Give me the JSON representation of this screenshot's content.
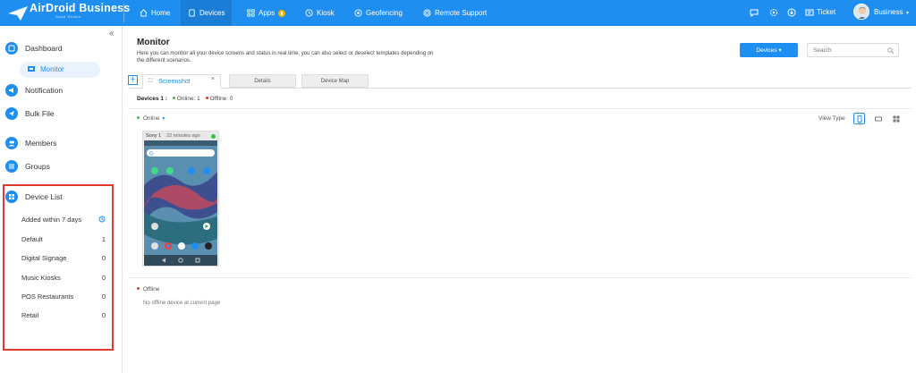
{
  "header": {
    "logo_title": "AirDroid Business",
    "logo_subtitle": "Sand Studio",
    "nav": [
      {
        "label": "Home",
        "icon": "home-icon"
      },
      {
        "label": "Devices",
        "icon": "devices-icon",
        "active": true
      },
      {
        "label": "Apps",
        "icon": "apps-icon"
      },
      {
        "label": "Kiosk",
        "icon": "kiosk-icon"
      },
      {
        "label": "Geofencing",
        "icon": "geofencing-icon"
      },
      {
        "label": "Remote Support",
        "icon": "remote-support-icon"
      }
    ],
    "ticket_label": "Ticket",
    "user_label": "Business",
    "accent_color": "#1e8ff0"
  },
  "sidebar": {
    "collapse_glyph": "«",
    "items": [
      {
        "label": "Dashboard",
        "icon": "dashboard-icon"
      },
      {
        "label": "Monitor",
        "icon": "monitor-icon",
        "active": true
      },
      {
        "label": "Notification",
        "icon": "notification-icon"
      },
      {
        "label": "Bulk File",
        "icon": "bulk-file-icon"
      },
      {
        "label": "Members",
        "icon": "members-icon"
      },
      {
        "label": "Groups",
        "icon": "groups-icon"
      },
      {
        "label": "Device List",
        "icon": "device-list-icon"
      }
    ],
    "device_list": [
      {
        "label": "Added within 7 days",
        "count": ""
      },
      {
        "label": "Default",
        "count": "1"
      },
      {
        "label": "Digital Signage",
        "count": "0"
      },
      {
        "label": "Music Kiosks",
        "count": "0"
      },
      {
        "label": "POS Restaurants",
        "count": "0"
      },
      {
        "label": "Retail",
        "count": "0"
      }
    ],
    "highlight_color": "#e03b2c"
  },
  "main": {
    "title": "Monitor",
    "description": "Here you can monitor all your device screens and status in real time, you can also select or deselect templates depending on the different scenarios.",
    "devices_button": "Devices ▾",
    "search_placeholder": "Search",
    "tabs": {
      "add": "+",
      "screenshot": "Screenshot",
      "close": "×",
      "details": "Details",
      "device_map": "Device Map"
    },
    "counts": {
      "devices": "Devices 1 :",
      "online": "Online: 1",
      "offline": "Offline: 0"
    },
    "online_label": "Online",
    "view_type_label": "View Type",
    "device_card": {
      "name": "Sony 1",
      "time": "22 minutes ago",
      "status_color": "#34c24a"
    },
    "offline_label": "Offline",
    "offline_message": "No offline device at current page"
  }
}
